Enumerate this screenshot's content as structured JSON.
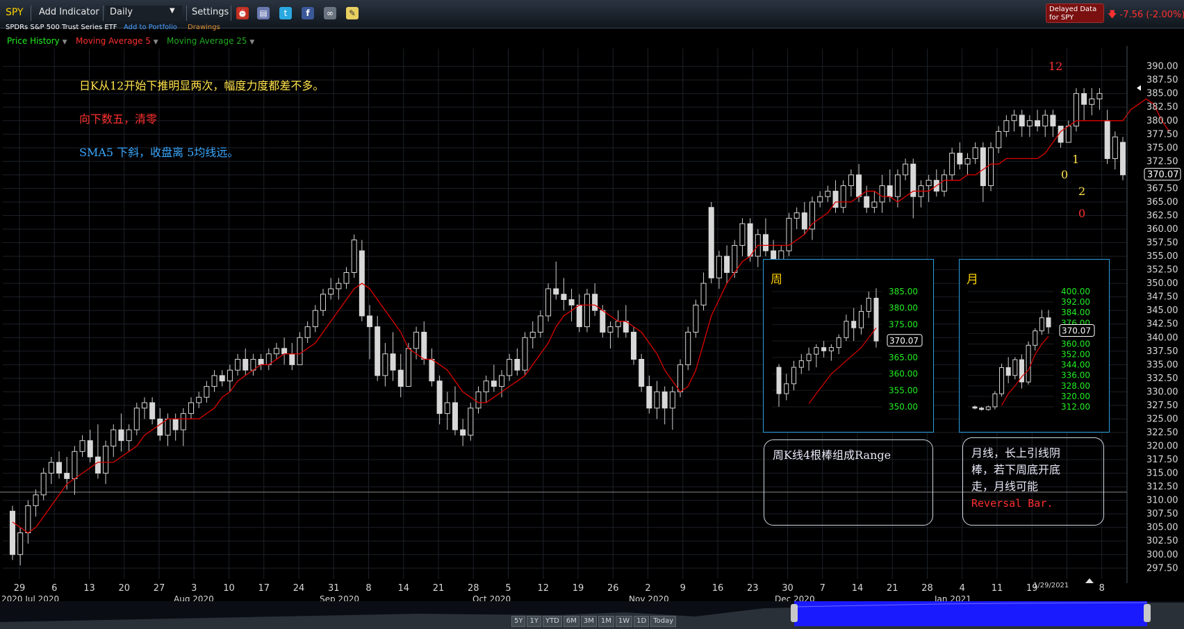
{
  "toolbar": {
    "ticker": "SPY",
    "add_indicator": "Add Indicator",
    "period": "Daily",
    "settings": "Settings",
    "delayed_line1": "Delayed Data",
    "delayed_line2": "for SPY",
    "change": "-7.56 (-2.00%)"
  },
  "subtitle": {
    "name": "SPDRs S&P 500 Trust Series ETF",
    "add_portfolio": "Add to Portfolio",
    "drawings": "Drawings"
  },
  "series_menu": {
    "price_history": "Price History",
    "ma5": "Moving Average 5",
    "ma25": "Moving Average 25"
  },
  "colors": {
    "up": "#d8d8d8",
    "ma5": "#e00000",
    "axis_text": "#d8d8d8",
    "grid": "#1c2128",
    "green_axis": "#22ee22"
  },
  "annotations": {
    "line1": "日K从12开始下推明显两次，幅度力度都差不多。",
    "line2": "向下数五，清零",
    "line3": "SMA5 下斜，收盘离 5均线远。",
    "count_12": "12",
    "count_1": "1",
    "count_0a": "0",
    "count_2": "2",
    "count_0b": "0",
    "weekly_note": "周K线4根棒组成Range",
    "monthly_note_1": "月线，长上引线阴",
    "monthly_note_2": "棒，若下周底开底",
    "monthly_note_3": "走，月线可能",
    "monthly_note_4": "Reversal Bar."
  },
  "last_price": "370.07",
  "last_date": "1/29/2021",
  "inset_weekly": {
    "title": "周",
    "ticks": [
      "385.00",
      "380.00",
      "375.00",
      "370.00",
      "365.00",
      "360.00",
      "355.00",
      "350.00"
    ],
    "last": "370.07"
  },
  "inset_monthly": {
    "title": "月",
    "ticks": [
      "400.00",
      "392.00",
      "384.00",
      "376.00",
      "368.00",
      "360.00",
      "352.00",
      "344.00",
      "336.00",
      "328.00",
      "320.00",
      "312.00"
    ],
    "last": "370.07"
  },
  "time_buttons": [
    "5Y",
    "1Y",
    "YTD",
    "6M",
    "3M",
    "1M",
    "1W",
    "1D",
    "Today"
  ],
  "chart_data": {
    "type": "candlestick",
    "ylim": [
      296,
      392
    ],
    "y_ticks": [
      390,
      387.5,
      385,
      382.5,
      380,
      377.5,
      375,
      372.5,
      370,
      367.5,
      365,
      362.5,
      360,
      357.5,
      355,
      352.5,
      350,
      347.5,
      345,
      342.5,
      340,
      337.5,
      335,
      332.5,
      330,
      327.5,
      325,
      322.5,
      320,
      317.5,
      315,
      312.5,
      310,
      307.5,
      305,
      302.5,
      300,
      297.5
    ],
    "x_tick_labels": [
      "29",
      "6",
      "13",
      "20",
      "27",
      "3",
      "10",
      "17",
      "24",
      "31",
      "8",
      "14",
      "21",
      "28",
      "5",
      "12",
      "19",
      "26",
      "2",
      "9",
      "16",
      "23",
      "30",
      "7",
      "14",
      "21",
      "28",
      "4",
      "11",
      "19",
      "",
      "8"
    ],
    "month_labels": [
      "2020 Jul 2020",
      "Aug 2020",
      "Sep 2020",
      "Oct 2020",
      "Nov 2020",
      "Dec 2020",
      "Jan 2021"
    ],
    "ohlc": [
      [
        308,
        309,
        299,
        300
      ],
      [
        300,
        305,
        298,
        304
      ],
      [
        304,
        310,
        302,
        309
      ],
      [
        309,
        312,
        307,
        311
      ],
      [
        311,
        316,
        310,
        315
      ],
      [
        315,
        318,
        313,
        317
      ],
      [
        317,
        319,
        314,
        315
      ],
      [
        315,
        318,
        312,
        314
      ],
      [
        314,
        320,
        311,
        319
      ],
      [
        319,
        322,
        318,
        321
      ],
      [
        321,
        323,
        317,
        318
      ],
      [
        318,
        324,
        314,
        315
      ],
      [
        315,
        321,
        313,
        320
      ],
      [
        320,
        324,
        318,
        323
      ],
      [
        323,
        326,
        319,
        321
      ],
      [
        321,
        324,
        319,
        323
      ],
      [
        323,
        328,
        322,
        327
      ],
      [
        327,
        329,
        325,
        328
      ],
      [
        328,
        329,
        324,
        325
      ],
      [
        325,
        327,
        321,
        322
      ],
      [
        322,
        326,
        320,
        325
      ],
      [
        325,
        326,
        321,
        323
      ],
      [
        323,
        327,
        320,
        326
      ],
      [
        326,
        329,
        325,
        328
      ],
      [
        328,
        330,
        327,
        329
      ],
      [
        329,
        332,
        328,
        331
      ],
      [
        331,
        334,
        330,
        333
      ],
      [
        333,
        334,
        331,
        332
      ],
      [
        332,
        335,
        330,
        334
      ],
      [
        334,
        337,
        333,
        336
      ],
      [
        336,
        338,
        333,
        334
      ],
      [
        334,
        337,
        333,
        336
      ],
      [
        336,
        337,
        334,
        335
      ],
      [
        335,
        338,
        334,
        337
      ],
      [
        337,
        339,
        336,
        338
      ],
      [
        338,
        340,
        335,
        337
      ],
      [
        337,
        339,
        334,
        335
      ],
      [
        335,
        341,
        335,
        340
      ],
      [
        340,
        343,
        339,
        342
      ],
      [
        342,
        346,
        341,
        345
      ],
      [
        345,
        349,
        344,
        348
      ],
      [
        348,
        351,
        347,
        349
      ],
      [
        349,
        351,
        347,
        350
      ],
      [
        350,
        353,
        349,
        352
      ],
      [
        352,
        359,
        351,
        358
      ],
      [
        356,
        358,
        343,
        344
      ],
      [
        344,
        346,
        336,
        342
      ],
      [
        342,
        344,
        332,
        333
      ],
      [
        333,
        339,
        331,
        337
      ],
      [
        337,
        341,
        332,
        334
      ],
      [
        334,
        337,
        329,
        331
      ],
      [
        331,
        339,
        331,
        338
      ],
      [
        338,
        342,
        336,
        341
      ],
      [
        341,
        343,
        335,
        336
      ],
      [
        336,
        338,
        331,
        332
      ],
      [
        332,
        333,
        324,
        326
      ],
      [
        326,
        330,
        323,
        328
      ],
      [
        328,
        331,
        322,
        323
      ],
      [
        323,
        325,
        320,
        322
      ],
      [
        322,
        328,
        321,
        327
      ],
      [
        327,
        331,
        326,
        330
      ],
      [
        330,
        333,
        328,
        332
      ],
      [
        332,
        335,
        330,
        331
      ],
      [
        331,
        334,
        329,
        333
      ],
      [
        333,
        337,
        332,
        336
      ],
      [
        336,
        338,
        333,
        334
      ],
      [
        334,
        341,
        333,
        340
      ],
      [
        340,
        343,
        338,
        341
      ],
      [
        341,
        345,
        340,
        344
      ],
      [
        344,
        350,
        343,
        349
      ],
      [
        349,
        354,
        347,
        348
      ],
      [
        348,
        351,
        345,
        347
      ],
      [
        347,
        349,
        343,
        346
      ],
      [
        346,
        348,
        341,
        342
      ],
      [
        342,
        349,
        341,
        348
      ],
      [
        348,
        350,
        344,
        345
      ],
      [
        345,
        346,
        340,
        341
      ],
      [
        341,
        343,
        338,
        342
      ],
      [
        342,
        345,
        340,
        343
      ],
      [
        343,
        346,
        340,
        341
      ],
      [
        341,
        342,
        335,
        336
      ],
      [
        336,
        337,
        330,
        331
      ],
      [
        331,
        333,
        326,
        327
      ],
      [
        327,
        332,
        325,
        330
      ],
      [
        330,
        331,
        324,
        327
      ],
      [
        327,
        331,
        323,
        330
      ],
      [
        330,
        336,
        329,
        335
      ],
      [
        335,
        342,
        334,
        341
      ],
      [
        341,
        347,
        340,
        346
      ],
      [
        346,
        352,
        345,
        350
      ],
      [
        364,
        365,
        350,
        351
      ],
      [
        351,
        356,
        349,
        355
      ],
      [
        355,
        357,
        350,
        352
      ],
      [
        352,
        358,
        351,
        357
      ],
      [
        357,
        362,
        355,
        361
      ],
      [
        361,
        362,
        354,
        355
      ],
      [
        355,
        360,
        353,
        359
      ],
      [
        359,
        362,
        355,
        356
      ],
      [
        356,
        358,
        352,
        353
      ],
      [
        353,
        357,
        352,
        356
      ],
      [
        356,
        363,
        355,
        362
      ],
      [
        362,
        364,
        360,
        363
      ],
      [
        363,
        365,
        359,
        360
      ],
      [
        360,
        366,
        358,
        365
      ],
      [
        365,
        367,
        364,
        366
      ],
      [
        366,
        368,
        365,
        367
      ],
      [
        367,
        369,
        363,
        364
      ],
      [
        364,
        369,
        363,
        368
      ],
      [
        368,
        371,
        366,
        370
      ],
      [
        370,
        372,
        365,
        366
      ],
      [
        366,
        368,
        363,
        364
      ],
      [
        364,
        367,
        363,
        365
      ],
      [
        365,
        370,
        363,
        368
      ],
      [
        368,
        371,
        365,
        366
      ],
      [
        366,
        371,
        364,
        370
      ],
      [
        370,
        373,
        369,
        372
      ],
      [
        372,
        373,
        362,
        366
      ],
      [
        366,
        369,
        364,
        368
      ],
      [
        368,
        370,
        365,
        369
      ],
      [
        369,
        371,
        366,
        367
      ],
      [
        367,
        371,
        366,
        370
      ],
      [
        370,
        375,
        369,
        374
      ],
      [
        374,
        376,
        371,
        372
      ],
      [
        372,
        374,
        370,
        373
      ],
      [
        373,
        376,
        372,
        375
      ],
      [
        375,
        376,
        365,
        368
      ],
      [
        368,
        376,
        367,
        375
      ],
      [
        375,
        379,
        374,
        378
      ],
      [
        378,
        381,
        377,
        380
      ],
      [
        380,
        382,
        378,
        381
      ],
      [
        381,
        382,
        377,
        379
      ],
      [
        379,
        381,
        377,
        380
      ],
      [
        380,
        382,
        378,
        379
      ],
      [
        379,
        382,
        377,
        381
      ],
      [
        381,
        382,
        377,
        379
      ],
      [
        379,
        378,
        375,
        376
      ],
      [
        376,
        380,
        376,
        379
      ],
      [
        379,
        386,
        378,
        385
      ],
      [
        385,
        386,
        380,
        383
      ],
      [
        383,
        386,
        381,
        384
      ],
      [
        384,
        386,
        382,
        385
      ],
      [
        380,
        382,
        372,
        373
      ],
      [
        373,
        378,
        371,
        377
      ],
      [
        376,
        377,
        369,
        370
      ]
    ],
    "ma5": [
      306,
      305,
      304,
      305,
      307,
      309,
      311,
      313,
      314,
      315,
      316,
      317,
      317,
      317,
      318,
      319,
      320,
      322,
      323,
      324,
      325,
      325,
      325,
      325,
      325,
      326,
      327,
      329,
      330,
      332,
      333,
      334,
      335,
      335,
      336,
      337,
      337,
      337,
      338,
      339,
      341,
      343,
      345,
      347,
      349,
      350,
      349,
      347,
      345,
      343,
      341,
      338,
      337,
      336,
      336,
      335,
      334,
      332,
      330,
      329,
      328,
      328,
      329,
      330,
      331,
      332,
      333,
      335,
      337,
      339,
      342,
      344,
      345,
      346,
      346,
      346,
      345,
      344,
      343,
      343,
      342,
      341,
      339,
      337,
      334,
      332,
      330,
      331,
      334,
      339,
      344,
      347,
      350,
      352,
      354,
      355,
      357,
      357,
      357,
      357,
      357,
      358,
      359,
      361,
      362,
      363,
      365,
      365,
      365,
      366,
      367,
      367,
      366,
      366,
      365,
      366,
      367,
      367,
      367,
      368,
      369,
      369,
      369,
      370,
      370,
      371,
      372,
      372,
      373,
      373,
      373,
      373,
      373,
      374,
      376,
      378,
      379,
      380,
      380,
      380,
      380,
      380,
      380,
      380,
      382,
      383,
      384,
      383,
      380,
      378
    ]
  }
}
